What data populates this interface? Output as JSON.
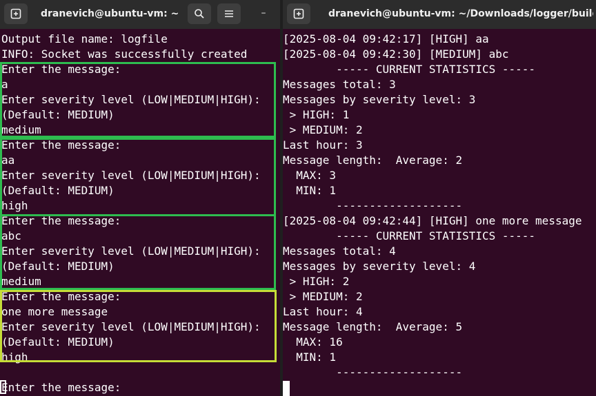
{
  "colors": {
    "terminal_bg": "#300a24",
    "box_green": "#2ebc4f",
    "box_yellow": "#c6dd38"
  },
  "left_window": {
    "title": "dranevich@ubuntu-vm: ~/...",
    "new_tab_icon": "new-tab-icon",
    "search_icon": "search-icon",
    "menu_icon": "hamburger-menu-icon",
    "minimize_glyph": "–",
    "lines": [
      "Output file name: logfile",
      "INFO: Socket was successfully created",
      "Enter the message:",
      "a",
      "Enter severity level (LOW|MEDIUM|HIGH):",
      "(Default: MEDIUM)",
      "medium",
      "Enter the message:",
      "aa",
      "Enter severity level (LOW|MEDIUM|HIGH):",
      "(Default: MEDIUM)",
      "high",
      "Enter the message:",
      "abc",
      "Enter severity level (LOW|MEDIUM|HIGH):",
      "(Default: MEDIUM)",
      "medium",
      "Enter the message:",
      "one more message",
      "Enter severity level (LOW|MEDIUM|HIGH):",
      "(Default: MEDIUM)",
      "high",
      "",
      "Enter the message:"
    ]
  },
  "right_window": {
    "title": "dranevich@ubuntu-vm: ~/Downloads/logger/build",
    "new_tab_icon": "new-tab-icon",
    "lines": [
      "[2025-08-04 09:42:17] [HIGH] aa",
      "[2025-08-04 09:42:30] [MEDIUM] abc",
      "        ----- CURRENT STATISTICS -----",
      "Messages total: 3",
      "Messages by severity level: 3",
      " > HIGH: 1",
      " > MEDIUM: 2",
      "Last hour: 3",
      "Message length:  Average: 2",
      "  MAX: 3",
      "  MIN: 1",
      "        -------------------",
      "[2025-08-04 09:42:44] [HIGH] one more message",
      "        ----- CURRENT STATISTICS -----",
      "Messages total: 4",
      "Messages by severity level: 4",
      " > HIGH: 2",
      " > MEDIUM: 2",
      "Last hour: 4",
      "Message length:  Average: 5",
      "  MAX: 16",
      "  MIN: 1",
      "        -------------------"
    ]
  }
}
